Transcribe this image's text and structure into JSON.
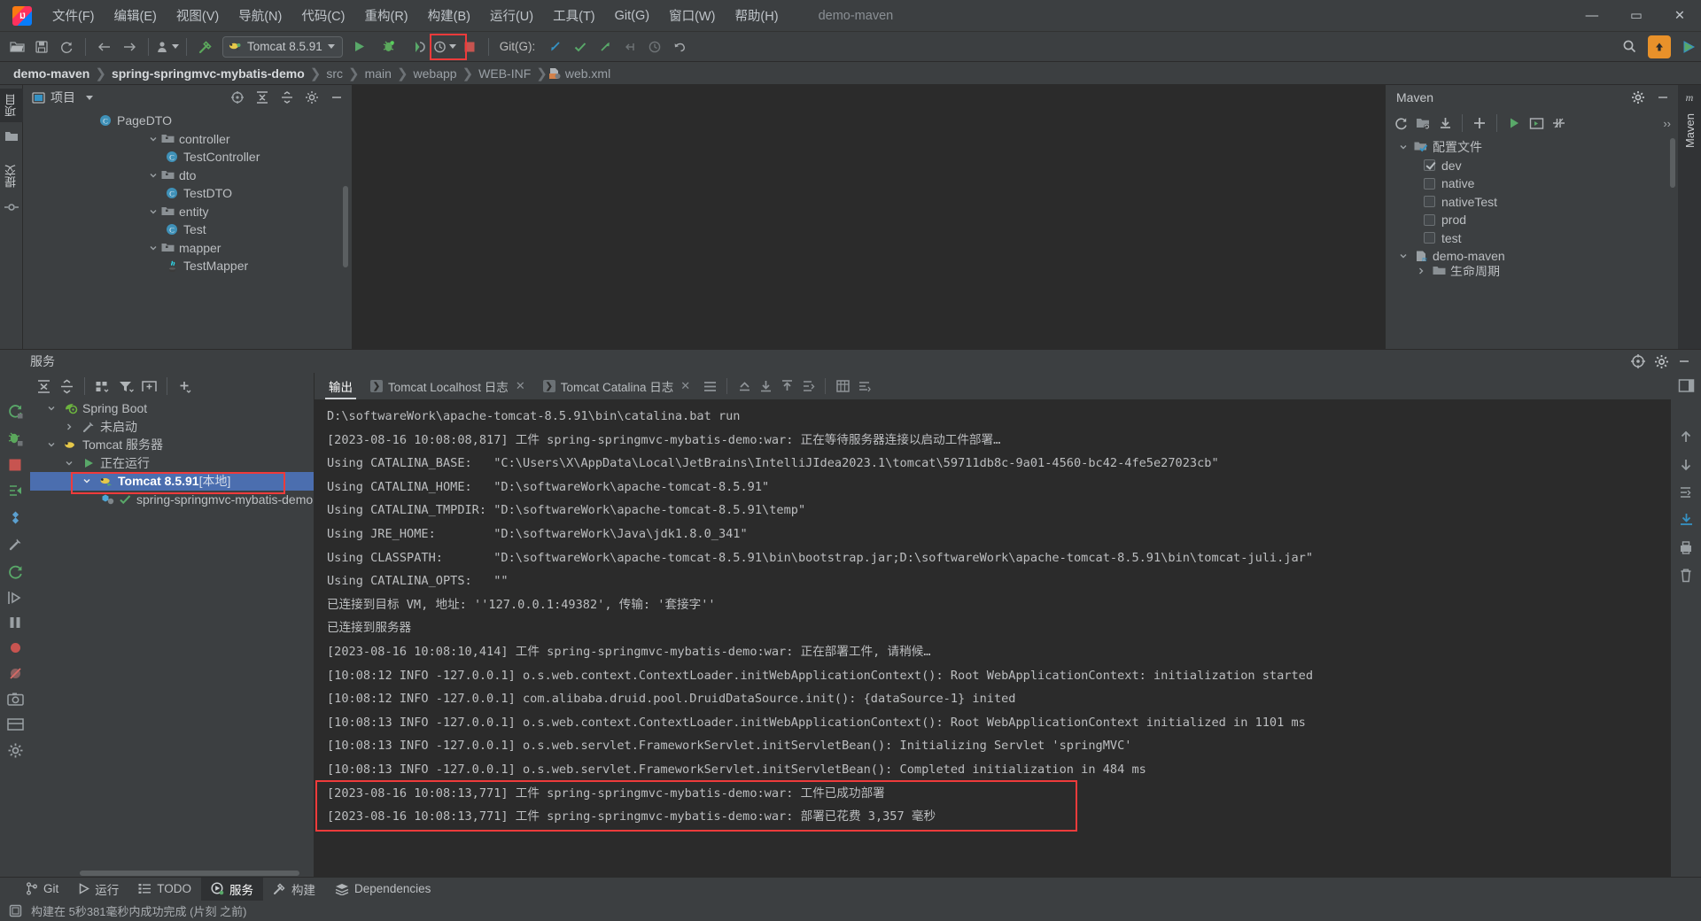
{
  "window": {
    "project_title": "demo-maven",
    "controls": {
      "minimize": "—",
      "maximize": "▭",
      "close": "✕"
    }
  },
  "menu": {
    "items": [
      {
        "label": "文件(F)",
        "name": "menu-file"
      },
      {
        "label": "编辑(E)",
        "name": "menu-edit"
      },
      {
        "label": "视图(V)",
        "name": "menu-view"
      },
      {
        "label": "导航(N)",
        "name": "menu-navigate"
      },
      {
        "label": "代码(C)",
        "name": "menu-code"
      },
      {
        "label": "重构(R)",
        "name": "menu-refactor"
      },
      {
        "label": "构建(B)",
        "name": "menu-build"
      },
      {
        "label": "运行(U)",
        "name": "menu-run"
      },
      {
        "label": "工具(T)",
        "name": "menu-tools"
      },
      {
        "label": "Git(G)",
        "name": "menu-git"
      },
      {
        "label": "窗口(W)",
        "name": "menu-window"
      },
      {
        "label": "帮助(H)",
        "name": "menu-help"
      }
    ]
  },
  "toolbar": {
    "run_config": "Tomcat 8.5.91",
    "git_label": "Git(G):",
    "accent_run_green": "#59a869",
    "highlight_red": "#ef3b3b"
  },
  "breadcrumb": {
    "items": [
      {
        "label": "demo-maven",
        "bold": true
      },
      {
        "label": "spring-springmvc-mybatis-demo",
        "bold": true
      },
      {
        "label": "src",
        "bold": false
      },
      {
        "label": "main",
        "bold": false
      },
      {
        "label": "webapp",
        "bold": false
      },
      {
        "label": "WEB-INF",
        "bold": false
      },
      {
        "label": "web.xml",
        "bold": false
      }
    ]
  },
  "left_strip": {
    "tabs": [
      {
        "label": "项目",
        "active": true
      },
      {
        "label": "提交",
        "active": false
      }
    ]
  },
  "project_panel": {
    "title": "项目",
    "tree": [
      {
        "label": "PageDTO",
        "indent": 5,
        "icon": "class-icon",
        "chevron": "none"
      },
      {
        "label": "controller",
        "indent": 4,
        "icon": "folder-icon",
        "chevron": "down"
      },
      {
        "label": "TestController",
        "indent": 5,
        "icon": "class-icon",
        "chevron": "none"
      },
      {
        "label": "dto",
        "indent": 4,
        "icon": "folder-icon",
        "chevron": "down"
      },
      {
        "label": "TestDTO",
        "indent": 5,
        "icon": "class-icon",
        "chevron": "none"
      },
      {
        "label": "entity",
        "indent": 4,
        "icon": "folder-icon",
        "chevron": "down"
      },
      {
        "label": "Test",
        "indent": 5,
        "icon": "class-icon",
        "chevron": "none"
      },
      {
        "label": "mapper",
        "indent": 4,
        "icon": "folder-icon",
        "chevron": "down"
      },
      {
        "label": "TestMapper",
        "indent": 5,
        "icon": "interface-java-icon",
        "chevron": "none"
      }
    ]
  },
  "maven_panel": {
    "title": "Maven",
    "vertical_tab": "Maven",
    "tree": [
      {
        "label": "配置文件",
        "indent": 1,
        "icon": "profiles-folder-icon",
        "chevron": "down",
        "checkbox": "none"
      },
      {
        "label": "dev",
        "indent": 2,
        "icon": "none",
        "chevron": "none",
        "checkbox": "checked"
      },
      {
        "label": "native",
        "indent": 2,
        "icon": "none",
        "chevron": "none",
        "checkbox": "unchecked"
      },
      {
        "label": "nativeTest",
        "indent": 2,
        "icon": "none",
        "chevron": "none",
        "checkbox": "unchecked"
      },
      {
        "label": "prod",
        "indent": 2,
        "icon": "none",
        "chevron": "none",
        "checkbox": "unchecked"
      },
      {
        "label": "test",
        "indent": 2,
        "icon": "none",
        "chevron": "none",
        "checkbox": "unchecked"
      },
      {
        "label": "demo-maven",
        "indent": 1,
        "icon": "maven-module-icon",
        "chevron": "down",
        "checkbox": "none"
      },
      {
        "label": "生命周期",
        "indent": 2,
        "icon": "folder-icon",
        "chevron": "right",
        "checkbox": "none"
      }
    ],
    "overflow_label": "››"
  },
  "services": {
    "header_title": "服务",
    "tree": [
      {
        "label": "Spring Boot",
        "indent": 1,
        "icon": "spring-icon",
        "chevron": "down",
        "selected": false,
        "bold": false
      },
      {
        "label": "未启动",
        "indent": 2,
        "icon": "wrench-icon",
        "chevron": "right",
        "selected": false,
        "bold": false
      },
      {
        "label": "Tomcat 服务器",
        "indent": 1,
        "icon": "tomcat-icon",
        "chevron": "down",
        "selected": false,
        "bold": false
      },
      {
        "label": "正在运行",
        "indent": 2,
        "icon": "run-green-icon",
        "chevron": "down",
        "selected": false,
        "bold": false
      },
      {
        "label": "Tomcat 8.5.91",
        "suffix": " [本地]",
        "indent": 3,
        "icon": "tomcat-run-icon",
        "chevron": "down",
        "selected": true,
        "bold": true
      },
      {
        "label": "spring-springmvc-mybatis-demo:w",
        "indent": 4,
        "icon": "artifact-ok-icon",
        "chevron": "none",
        "selected": false,
        "bold": false
      }
    ]
  },
  "console_tabs": [
    {
      "label": "输出",
      "active": true,
      "closable": false,
      "has_run_icon": false
    },
    {
      "label": "Tomcat Localhost 日志",
      "active": false,
      "closable": true,
      "has_run_icon": true
    },
    {
      "label": "Tomcat Catalina 日志",
      "active": false,
      "closable": true,
      "has_run_icon": true
    }
  ],
  "console": {
    "lines": [
      "D:\\softwareWork\\apache-tomcat-8.5.91\\bin\\catalina.bat run",
      "[2023-08-16 10:08:08,817] 工件 spring-springmvc-mybatis-demo:war: 正在等待服务器连接以启动工件部署…",
      "Using CATALINA_BASE:   \"C:\\Users\\X\\AppData\\Local\\JetBrains\\IntelliJIdea2023.1\\tomcat\\59711db8c-9a01-4560-bc42-4fe5e27023cb\"",
      "Using CATALINA_HOME:   \"D:\\softwareWork\\apache-tomcat-8.5.91\"",
      "Using CATALINA_TMPDIR: \"D:\\softwareWork\\apache-tomcat-8.5.91\\temp\"",
      "Using JRE_HOME:        \"D:\\softwareWork\\Java\\jdk1.8.0_341\"",
      "Using CLASSPATH:       \"D:\\softwareWork\\apache-tomcat-8.5.91\\bin\\bootstrap.jar;D:\\softwareWork\\apache-tomcat-8.5.91\\bin\\tomcat-juli.jar\"",
      "Using CATALINA_OPTS:   \"\"",
      "已连接到目标 VM, 地址: ''127.0.0.1:49382', 传输: '套接字''",
      "已连接到服务器",
      "[2023-08-16 10:08:10,414] 工件 spring-springmvc-mybatis-demo:war: 正在部署工件, 请稍候…",
      "[10:08:12 INFO -127.0.0.1] o.s.web.context.ContextLoader.initWebApplicationContext(): Root WebApplicationContext: initialization started",
      "[10:08:12 INFO -127.0.0.1] com.alibaba.druid.pool.DruidDataSource.init(): {dataSource-1} inited",
      "[10:08:13 INFO -127.0.0.1] o.s.web.context.ContextLoader.initWebApplicationContext(): Root WebApplicationContext initialized in 1101 ms",
      "[10:08:13 INFO -127.0.0.1] o.s.web.servlet.FrameworkServlet.initServletBean(): Initializing Servlet 'springMVC'",
      "[10:08:13 INFO -127.0.0.1] o.s.web.servlet.FrameworkServlet.initServletBean(): Completed initialization in 484 ms",
      "[2023-08-16 10:08:13,771] 工件 spring-springmvc-mybatis-demo:war: 工件已成功部署",
      "[2023-08-16 10:08:13,771] 工件 spring-springmvc-mybatis-demo:war: 部署已花费 3,357 毫秒"
    ]
  },
  "bottom_bar": {
    "items": [
      {
        "label": "Git",
        "icon": "git-branch-icon",
        "active": false
      },
      {
        "label": "运行",
        "icon": "run-icon",
        "active": false
      },
      {
        "label": "TODO",
        "icon": "todo-list-icon",
        "active": false
      },
      {
        "label": "服务",
        "icon": "services-icon",
        "active": true
      },
      {
        "label": "构建",
        "icon": "build-hammer-icon",
        "active": false
      },
      {
        "label": "Dependencies",
        "icon": "dependencies-icon",
        "active": false
      }
    ]
  },
  "status_bar": {
    "message": "构建在 5秒381毫秒内成功完成 (片刻 之前)"
  }
}
